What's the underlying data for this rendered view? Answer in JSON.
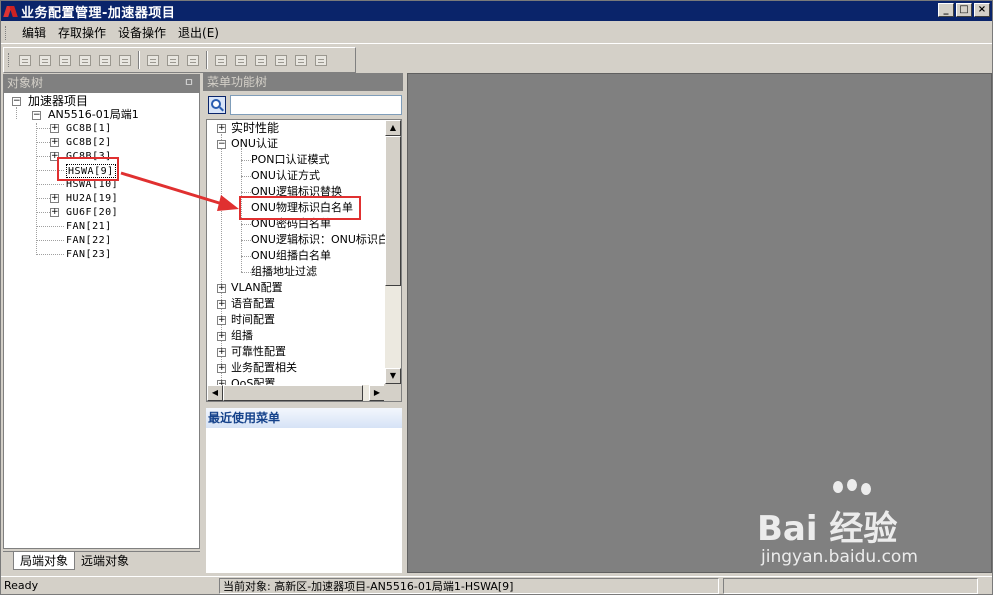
{
  "window": {
    "title": "业务配置管理-加速器项目",
    "controls": [
      "_",
      "□",
      "×"
    ]
  },
  "menubar": {
    "items": [
      "编辑",
      "存取操作",
      "设备操作",
      "退出(E)"
    ]
  },
  "toolbar": {
    "icons": [
      "check-doc-icon",
      "chart-doc-icon",
      "table-icon",
      "paste-icon",
      "export-icon",
      "up-arrow-icon",
      "folder-icon",
      "folder-open-icon",
      "folder-save-icon",
      "copy-icon",
      "card-icon",
      "exit-icon",
      "upload-icon",
      "edit-icon",
      "edit2-icon"
    ]
  },
  "object_tree": {
    "header": "对象树",
    "pin": "ㅁ",
    "nodes": {
      "root": "加速器项目",
      "device": "AN5516-01局端1",
      "gc8b1": "GC8B[1]",
      "gc8b2": "GC8B[2]",
      "gc8b3": "GC8B[3]",
      "hswa9": "HSWA[9]",
      "hswa10": "HSWA[10]",
      "hu2a19": "HU2A[19]",
      "gu6f20": "GU6F[20]",
      "fan21": "FAN[21]",
      "fan22": "FAN[22]",
      "fan23": "FAN[23]"
    },
    "tabs": [
      "局端对象",
      "远端对象"
    ]
  },
  "menu_tree": {
    "header": "菜单功能树",
    "search_placeholder": "",
    "items": {
      "realtime": "实时性能",
      "onu_auth": "ONU认证",
      "pon_auth_mode": "PON口认证模式",
      "onu_auth_method": "ONU认证方式",
      "onu_logic_replace": "ONU逻辑标识替换",
      "onu_phys_whitelist": "ONU物理标识白名单",
      "onu_pwd_whitelist": "ONU密码白名单",
      "onu_logic_id": "ONU逻辑标识：ONU标识白",
      "onu_group_whitelist": "ONU组播白名单",
      "mcast_filter": "组播地址过滤",
      "vlan": "VLAN配置",
      "voice": "语音配置",
      "time": "时间配置",
      "mcast": "组播",
      "reliability": "可靠性配置",
      "service": "业务配置相关",
      "qos": "QoS配置"
    },
    "recent_header": "最近使用菜单"
  },
  "statusbar": {
    "ready": "Ready",
    "current": "当前对象: 高新区-加速器项目-AN5516-01局端1-HSWA[9]"
  },
  "watermark": {
    "brand": "Bai 经验",
    "url": "jingyan.baidu.com"
  },
  "colors": {
    "titlebar": "#0a246a",
    "panel_header": "#808080",
    "content_bg": "#808080",
    "annotation": "#e03030",
    "recent_header_text": "#15428b"
  }
}
